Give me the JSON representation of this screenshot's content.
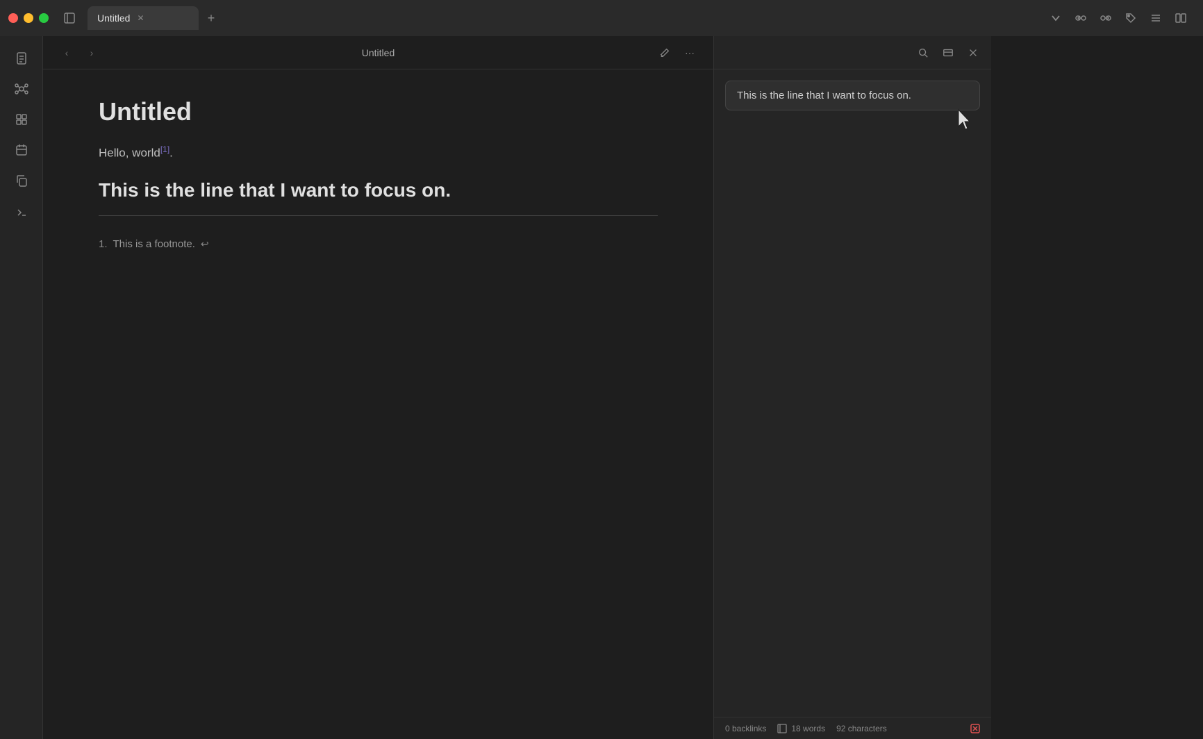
{
  "titlebar": {
    "tab_title": "Untitled",
    "new_tab_label": "+",
    "sidebar_toggle_icon": "sidebar-icon",
    "chevron_down_icon": "chevron-down",
    "backlinks_icon": "backlinks",
    "forward_links_icon": "forward-links",
    "tag_icon": "tag",
    "list_icon": "list",
    "split_icon": "split-view"
  },
  "sidebar": {
    "items": [
      {
        "icon": "file",
        "label": "Files"
      },
      {
        "icon": "graph",
        "label": "Graph"
      },
      {
        "icon": "grid",
        "label": "Grid"
      },
      {
        "icon": "calendar",
        "label": "Calendar"
      },
      {
        "icon": "copy",
        "label": "Copy"
      },
      {
        "icon": "terminal",
        "label": "Terminal"
      }
    ]
  },
  "editor": {
    "title": "Untitled",
    "back_btn": "‹",
    "forward_btn": "›",
    "edit_btn": "✏",
    "more_btn": "…",
    "doc_title": "Untitled",
    "paragraph": "Hello, world",
    "footnote_ref": "[1]",
    "paragraph_suffix": ".",
    "heading": "This is the line that I want to focus on.",
    "footnote_number": "1.",
    "footnote_text": "This is a footnote.",
    "footnote_return": "↩"
  },
  "right_panel": {
    "search_icon": "search",
    "rect_icon": "rectangle",
    "close_icon": "close",
    "tooltip_text": "This is the line that I want to focus on.",
    "cursor_icon": "cursor"
  },
  "status_bar": {
    "backlinks_count": "0 backlinks",
    "book_icon": "book",
    "word_count": "18 words",
    "char_count": "92 characters",
    "error_icon": "error-x"
  }
}
